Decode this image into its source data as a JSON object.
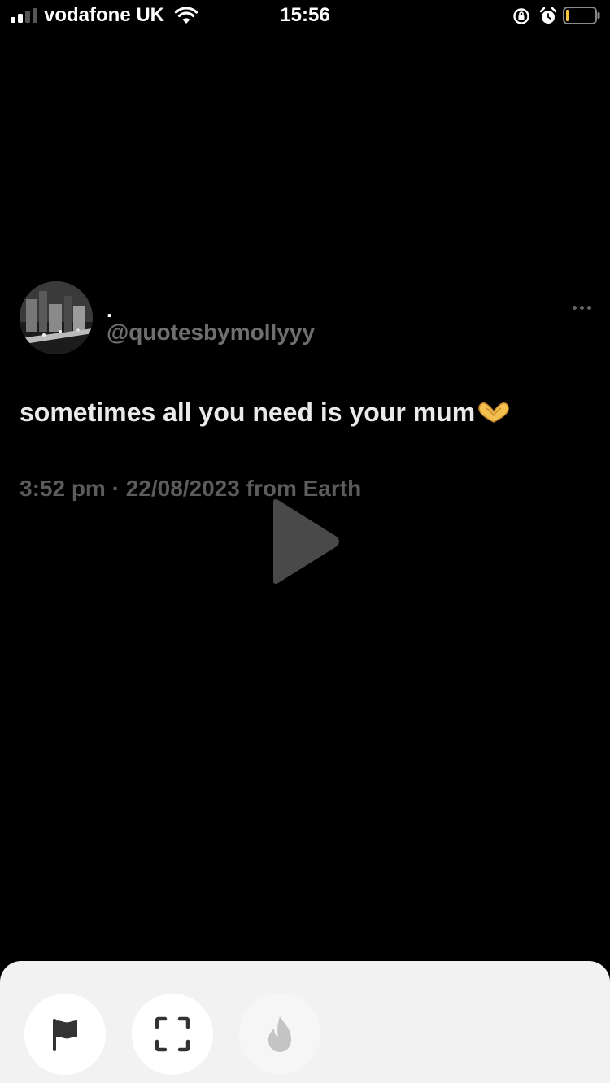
{
  "status_bar": {
    "carrier": "vodafone UK",
    "time": "15:56",
    "signal_icon": "signal-bars-icon",
    "wifi_icon": "wifi-icon",
    "rotation_lock_icon": "rotation-lock-icon",
    "alarm_icon": "alarm-clock-icon",
    "battery_icon": "battery-low-icon",
    "battery_accent": "#f5c542"
  },
  "post": {
    "display_name": ".",
    "handle": "@quotesbymollyyy",
    "text": "sometimes all you need is your mum",
    "emoji_icon": "heart-hands-icon",
    "timestamp": "3:52 pm · 22/08/2023 from Earth",
    "more_icon": "more-dots-icon"
  },
  "player": {
    "play_icon": "play-icon"
  },
  "bottom_actions": [
    {
      "icon": "flag-icon"
    },
    {
      "icon": "fullscreen-icon"
    },
    {
      "icon": "fire-icon"
    }
  ],
  "colors": {
    "background": "#000000",
    "handle_gray": "#6f6f6f",
    "timestamp_gray": "#5c5c5c",
    "sheet": "#f2f2f2"
  }
}
